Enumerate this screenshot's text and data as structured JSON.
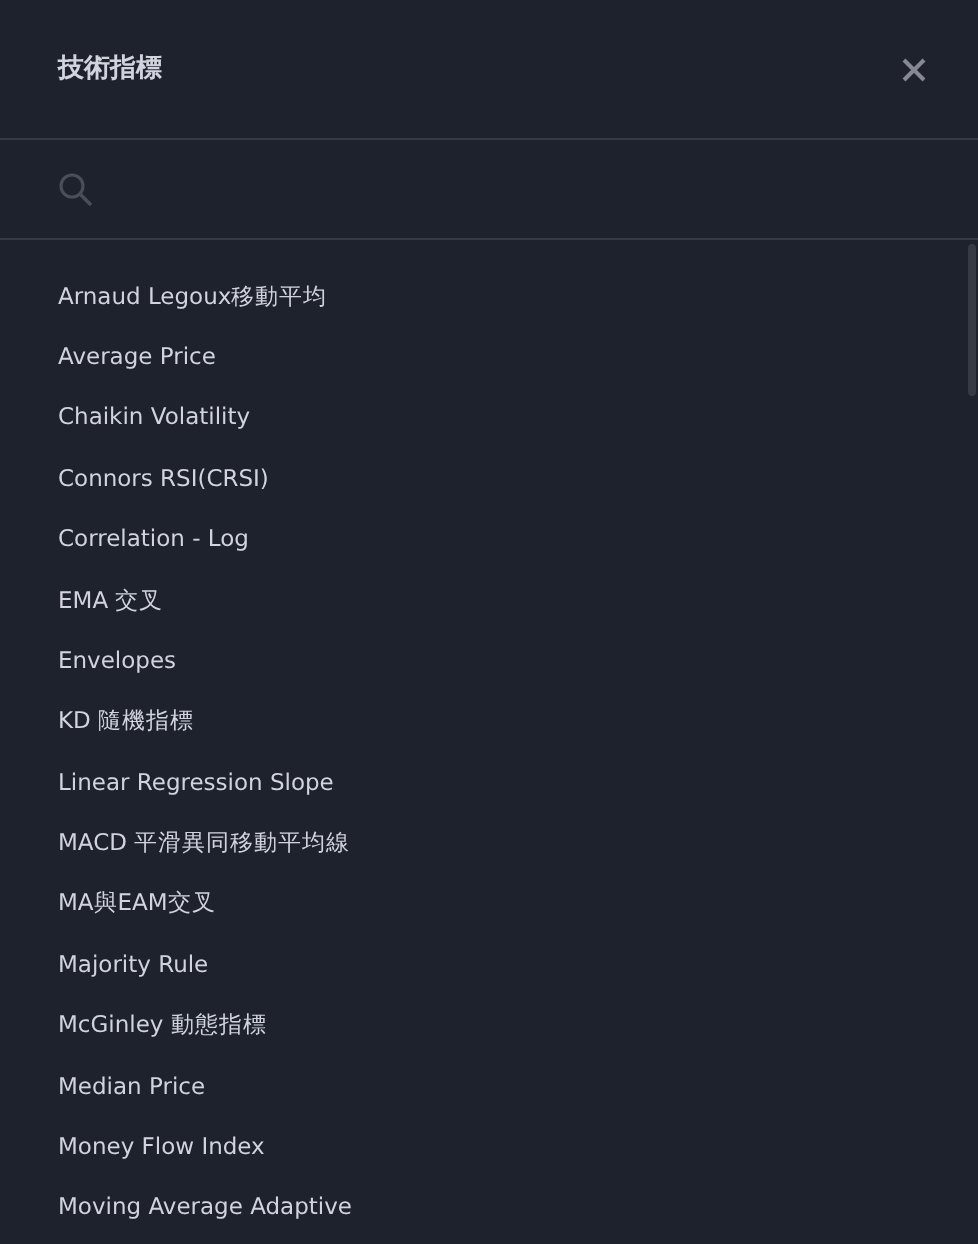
{
  "dialog": {
    "title": "技術指標"
  },
  "indicators": [
    {
      "label": "Arnaud Legoux移動平均"
    },
    {
      "label": "Average Price"
    },
    {
      "label": "Chaikin Volatility"
    },
    {
      "label": "Connors RSI(CRSI)"
    },
    {
      "label": "Correlation - Log"
    },
    {
      "label": "EMA 交叉"
    },
    {
      "label": "Envelopes"
    },
    {
      "label": "KD 隨機指標"
    },
    {
      "label": "Linear Regression Slope"
    },
    {
      "label": "MACD 平滑異同移動平均線"
    },
    {
      "label": "MA與EAM交叉"
    },
    {
      "label": "Majority Rule"
    },
    {
      "label": "McGinley 動態指標"
    },
    {
      "label": "Median Price"
    },
    {
      "label": "Money Flow Index"
    },
    {
      "label": "Moving Average Adaptive"
    }
  ]
}
